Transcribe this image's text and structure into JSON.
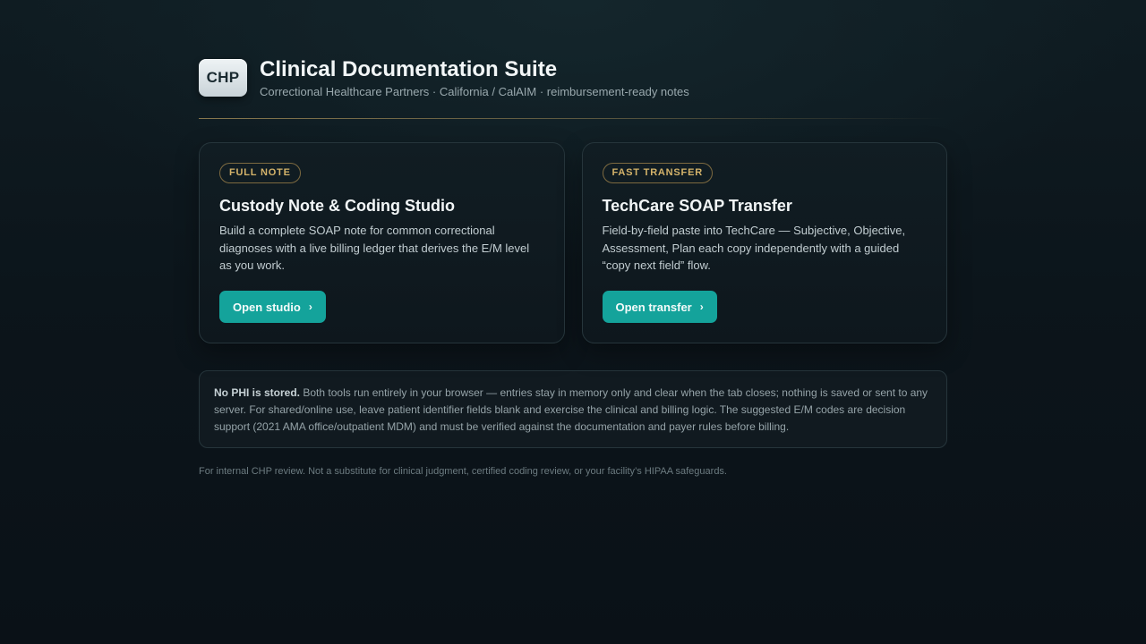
{
  "header": {
    "logo_text": "CHP",
    "title": "Clinical Documentation Suite",
    "subtitle": "Correctional Healthcare Partners · California / CalAIM · reimbursement-ready notes"
  },
  "cards": [
    {
      "badge": "FULL NOTE",
      "title": "Custody Note & Coding Studio",
      "description": "Build a complete SOAP note for common correctional diagnoses with a live billing ledger that derives the E/M level as you work.",
      "button_label": "Open studio",
      "button_icon": "chevron-right-icon"
    },
    {
      "badge": "FAST TRANSFER",
      "title": "TechCare SOAP Transfer",
      "description": "Field-by-field paste into TechCare — Subjective, Objective, Assessment, Plan each copy independently with a guided “copy next field” flow.",
      "button_label": "Open transfer",
      "button_icon": "chevron-right-icon"
    }
  ],
  "notice": {
    "bold": "No PHI is stored.",
    "text": " Both tools run entirely in your browser — entries stay in memory only and clear when the tab closes; nothing is saved or sent to any server. For shared/online use, leave patient identifier fields blank and exercise the clinical and billing logic. The suggested E/M codes are decision support (2021 AMA office/outpatient MDM) and must be verified against the documentation and payer rules before billing."
  },
  "footnote": "For internal CHP review. Not a substitute for clinical judgment, certified coding review, or your facility’s HIPAA safeguards.",
  "colors": {
    "accent": "#14a39b",
    "badge": "#d4b36a",
    "background": "#0c151b"
  }
}
